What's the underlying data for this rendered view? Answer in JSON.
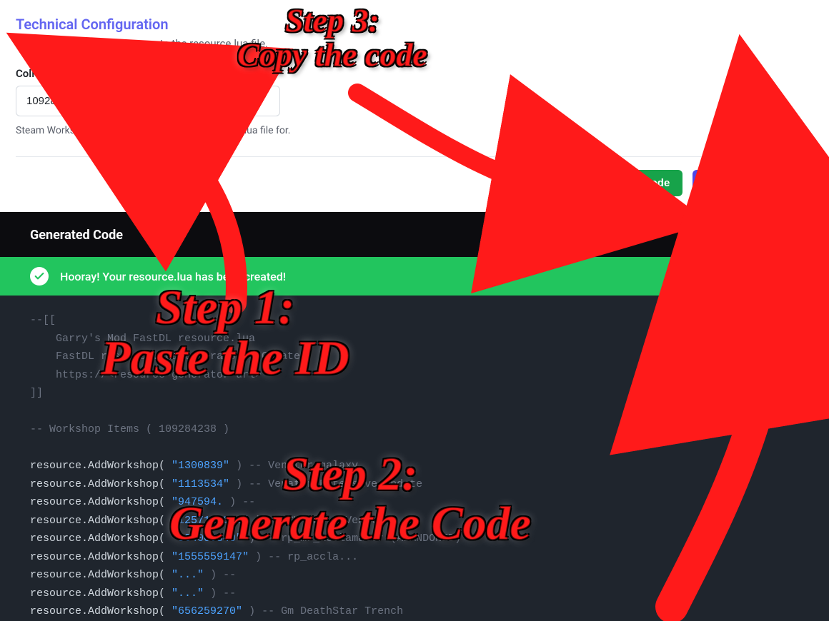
{
  "config": {
    "title": "Technical Configuration",
    "description": "Necessary Information to create the resource.lua file.",
    "field_label": "Collection ID",
    "field_value": "109284238",
    "field_help": "Steam Workshop Collection ID to create a resource.lua file for."
  },
  "buttons": {
    "copy": "Copy Code",
    "generate": "Generate Code"
  },
  "generated": {
    "header": "Generated Code",
    "success": "Hooray! Your resource.lua has been created!"
  },
  "code": {
    "c1": "--[[",
    "c2": "    Garry's Mod FastDL resource.lua",
    "c3": "    FastDL resource.lua Generator - Create",
    "c4": "    https://<resource-generator-url>",
    "c5": "]]",
    "c6": "-- Workshop Items ( 109284238 )",
    "fn": "resource.AddWorkshop( ",
    "items": [
      {
        "id": "\"1300839\"",
        "cm": " ) -- Venator galaxy"
      },
      {
        "id": "\"1113534\"",
        "cm": " ) -- Venator Extensive Update"
      },
      {
        "id": "\"947594.",
        "cm": " ) -- "
      },
      {
        "id": "\"1257128301\"",
        "cm": " ) -- SW Map   Venator"
      },
      {
        "id": "\"834000840\"",
        "cm": " ) -- rp_mr_acclamator (ABANDONED)"
      },
      {
        "id": "\"1555559147\"",
        "cm": " ) -- rp_accla..."
      },
      {
        "id": "\"...\"",
        "cm": " ) -- "
      },
      {
        "id": "\"...\"",
        "cm": " ) -- "
      },
      {
        "id": "\"656259270\"",
        "cm": " ) -- Gm DeathStar Trench"
      }
    ]
  },
  "annotations": {
    "step1a": "Step 1:",
    "step1b": "Paste the ID",
    "step2a": "Step 2:",
    "step2b": "Generate the Code",
    "step3a": "Step 3:",
    "step3b": "Copy the code"
  },
  "colors": {
    "accent_purple": "#4f46e5",
    "accent_green": "#17a34a",
    "annotation_red": "#ff1a1a"
  }
}
